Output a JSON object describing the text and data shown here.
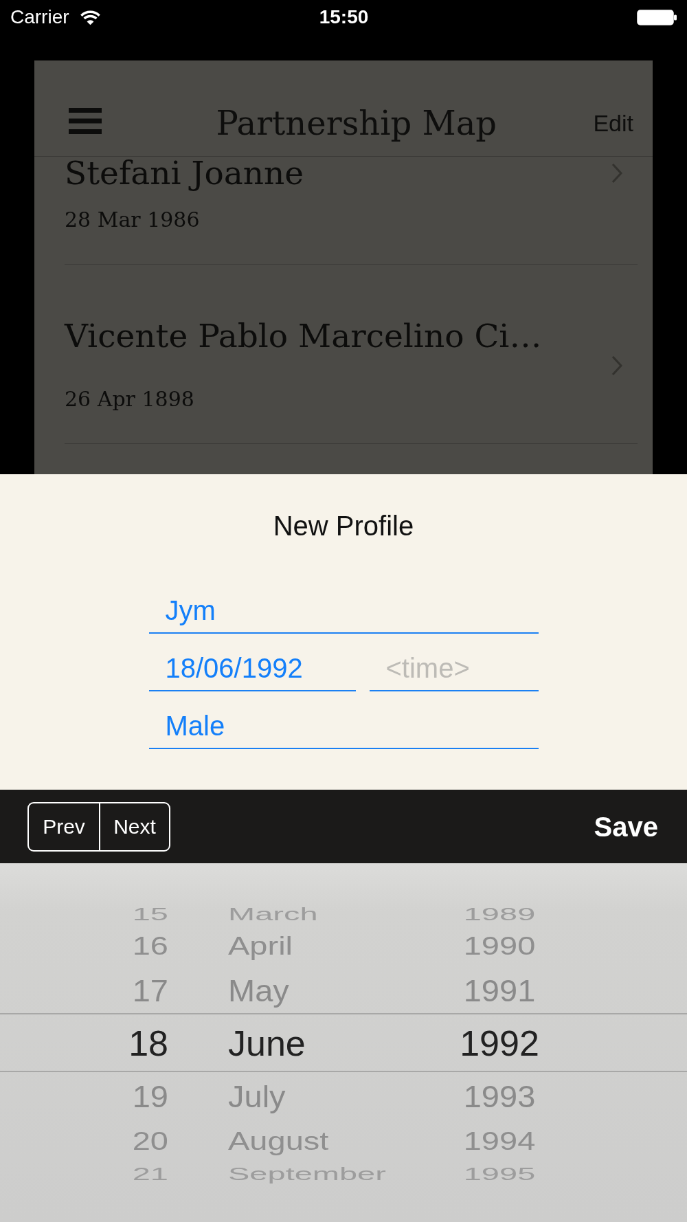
{
  "status_bar": {
    "carrier": "Carrier",
    "time": "15:50"
  },
  "nav_bar": {
    "title": "Partnership Map",
    "right_button": "Edit"
  },
  "list": {
    "rows": [
      {
        "name": "Stefani Joanne",
        "date": "28 Mar 1986"
      },
      {
        "name": "Vicente Pablo Marcelino Ci…",
        "date": "26 Apr 1898"
      }
    ]
  },
  "form": {
    "title": "New Profile",
    "field_rows": [
      {
        "fields": [
          {
            "value": "Jym"
          }
        ]
      },
      {
        "fields": [
          {
            "value": "18/06/1992"
          },
          {
            "placeholder": "<time>"
          }
        ]
      },
      {
        "fields": [
          {
            "value": "Male"
          }
        ]
      }
    ]
  },
  "toolbar": {
    "segments": [
      "Prev",
      "Next"
    ],
    "action": "Save"
  },
  "picker": {
    "columns": [
      {
        "kind": "day",
        "items": [
          {
            "label": "15",
            "selected": false
          },
          {
            "label": "16",
            "selected": false
          },
          {
            "label": "17",
            "selected": false
          },
          {
            "label": "18",
            "selected": true
          },
          {
            "label": "19",
            "selected": false
          },
          {
            "label": "20",
            "selected": false
          },
          {
            "label": "21",
            "selected": false
          }
        ]
      },
      {
        "kind": "month",
        "items": [
          {
            "label": "March",
            "selected": false
          },
          {
            "label": "April",
            "selected": false
          },
          {
            "label": "May",
            "selected": false
          },
          {
            "label": "June",
            "selected": true
          },
          {
            "label": "July",
            "selected": false
          },
          {
            "label": "August",
            "selected": false
          },
          {
            "label": "September",
            "selected": false
          }
        ]
      },
      {
        "kind": "year",
        "items": [
          {
            "label": "1989",
            "selected": false
          },
          {
            "label": "1990",
            "selected": false
          },
          {
            "label": "1991",
            "selected": false
          },
          {
            "label": "1992",
            "selected": true
          },
          {
            "label": "1993",
            "selected": false
          },
          {
            "label": "1994",
            "selected": false
          },
          {
            "label": "1995",
            "selected": false
          }
        ]
      }
    ]
  }
}
